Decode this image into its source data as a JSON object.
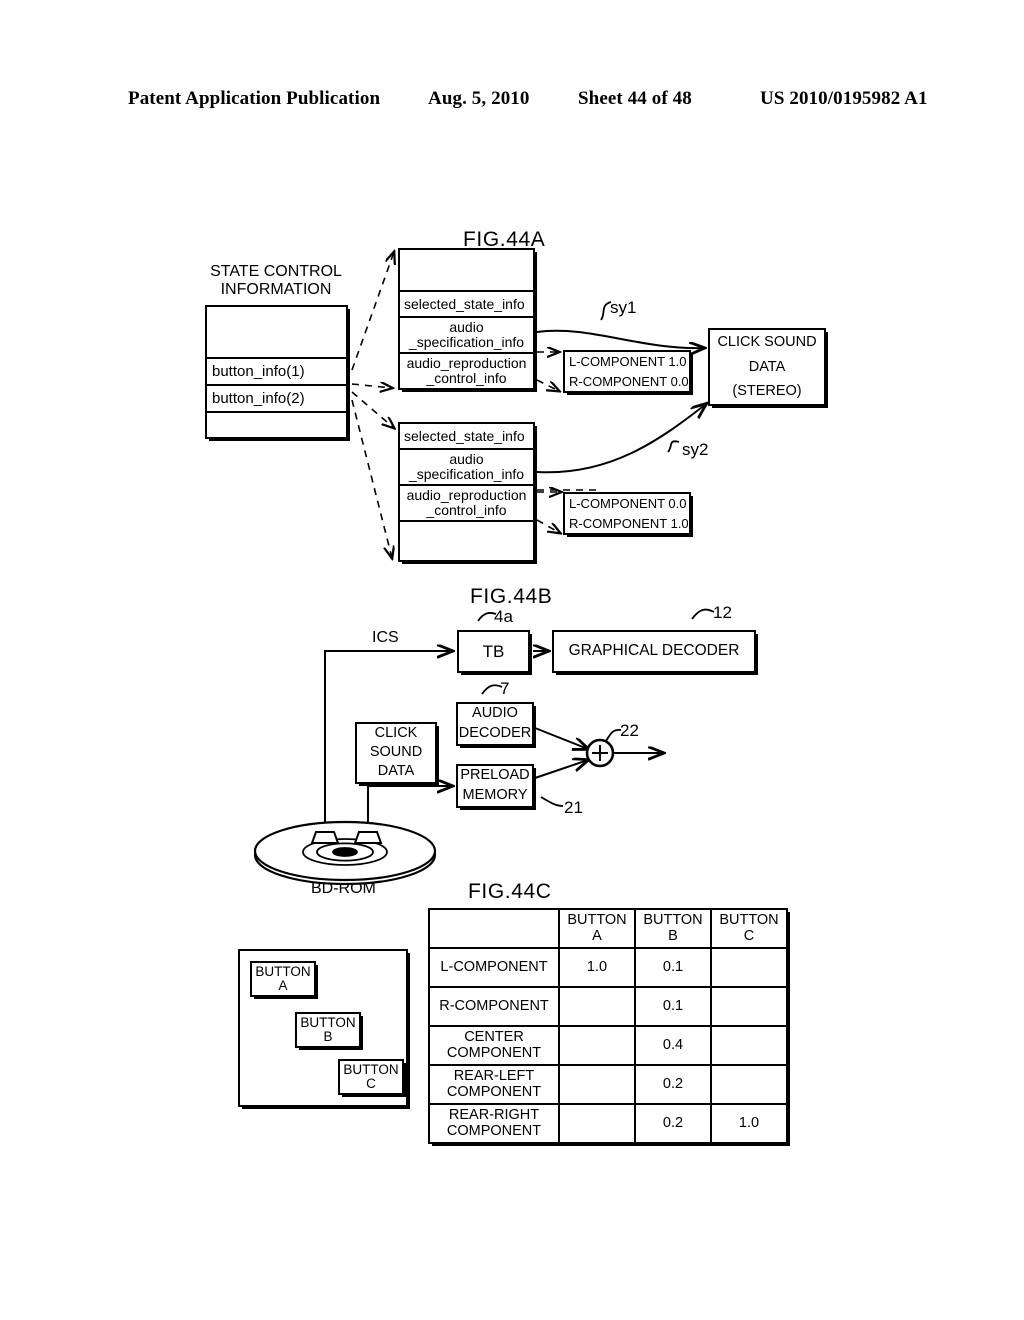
{
  "header": {
    "publication": "Patent Application Publication",
    "date": "Aug. 5, 2010",
    "sheet": "Sheet 44 of 48",
    "number": "US 2010/0195982 A1"
  },
  "figures": {
    "a_label": "FIG.44A",
    "b_label": "FIG.44B",
    "c_label": "FIG.44C"
  },
  "fig44a": {
    "state_control_title_line1": "STATE CONTROL",
    "state_control_title_line2": "INFORMATION",
    "state_control_rows": [
      "",
      "button_info(1)",
      "button_info(2)",
      ""
    ],
    "button_info_block_1": {
      "rows": [
        "",
        "selected_state_info",
        "audio\n_specification_info",
        "audio_reproduction\n_control_info"
      ],
      "row_empty": "",
      "row_selected": "selected_state_info",
      "row_audio_spec_1": "audio",
      "row_audio_spec_2": "_specification_info",
      "row_audio_repro_1": "audio_reproduction",
      "row_audio_repro_2": "_control_info"
    },
    "button_info_block_2": {
      "row_selected": "selected_state_info",
      "row_audio_spec_1": "audio",
      "row_audio_spec_2": "_specification_info",
      "row_audio_repro_1": "audio_reproduction",
      "row_audio_repro_2": "_control_info",
      "row_empty": ""
    },
    "mix_box_1": {
      "line1": "L-COMPONENT 1.0",
      "line2": "R-COMPONENT 0.0"
    },
    "mix_box_2": {
      "line1": "L-COMPONENT 0.0",
      "line2": "R-COMPONENT 1.0"
    },
    "click_sound_data": {
      "line1": "CLICK SOUND",
      "line2": "DATA",
      "line3": "(STEREO)"
    },
    "callout_sy1": "sy1",
    "callout_sy2": "sy2"
  },
  "fig44b": {
    "ics_label": "ICS",
    "tb_label": "TB",
    "tb_ref": "4a",
    "graphical_decoder_label": "GRAPHICAL DECODER",
    "graphical_decoder_ref": "12",
    "audio_decoder_line1": "AUDIO",
    "audio_decoder_line2": "DECODER",
    "audio_decoder_ref": "7",
    "preload_memory_line1": "PRELOAD",
    "preload_memory_line2": "MEMORY",
    "preload_memory_ref": "21",
    "click_sound_data_line1": "CLICK",
    "click_sound_data_line2": "SOUND",
    "click_sound_data_line3": "DATA",
    "adder_ref": "22",
    "adder_glyph": "+",
    "bd_rom_label": "BD-ROM"
  },
  "fig44c": {
    "columns": [
      "",
      "BUTTON\nA",
      "BUTTON\nB",
      "BUTTON\nC"
    ],
    "col_blank": "",
    "col_a_line1": "BUTTON",
    "col_a_line2": "A",
    "col_b_line1": "BUTTON",
    "col_b_line2": "B",
    "col_c_line1": "BUTTON",
    "col_c_line2": "C",
    "rows": [
      {
        "label_line1": "L-COMPONENT",
        "label_line2": "",
        "a": "1.0",
        "b": "0.1",
        "c": ""
      },
      {
        "label_line1": "R-COMPONENT",
        "label_line2": "",
        "a": "",
        "b": "0.1",
        "c": ""
      },
      {
        "label_line1": "CENTER",
        "label_line2": "COMPONENT",
        "a": "",
        "b": "0.4",
        "c": ""
      },
      {
        "label_line1": "REAR-LEFT",
        "label_line2": "COMPONENT",
        "a": "",
        "b": "0.2",
        "c": ""
      },
      {
        "label_line1": "REAR-RIGHT",
        "label_line2": "COMPONENT",
        "a": "",
        "b": "0.2",
        "c": "1.0"
      }
    ],
    "button_panel": {
      "button_a_line1": "BUTTON",
      "button_a_line2": "A",
      "button_b_line1": "BUTTON",
      "button_b_line2": "B",
      "button_c_line1": "BUTTON",
      "button_c_line2": "C"
    }
  }
}
